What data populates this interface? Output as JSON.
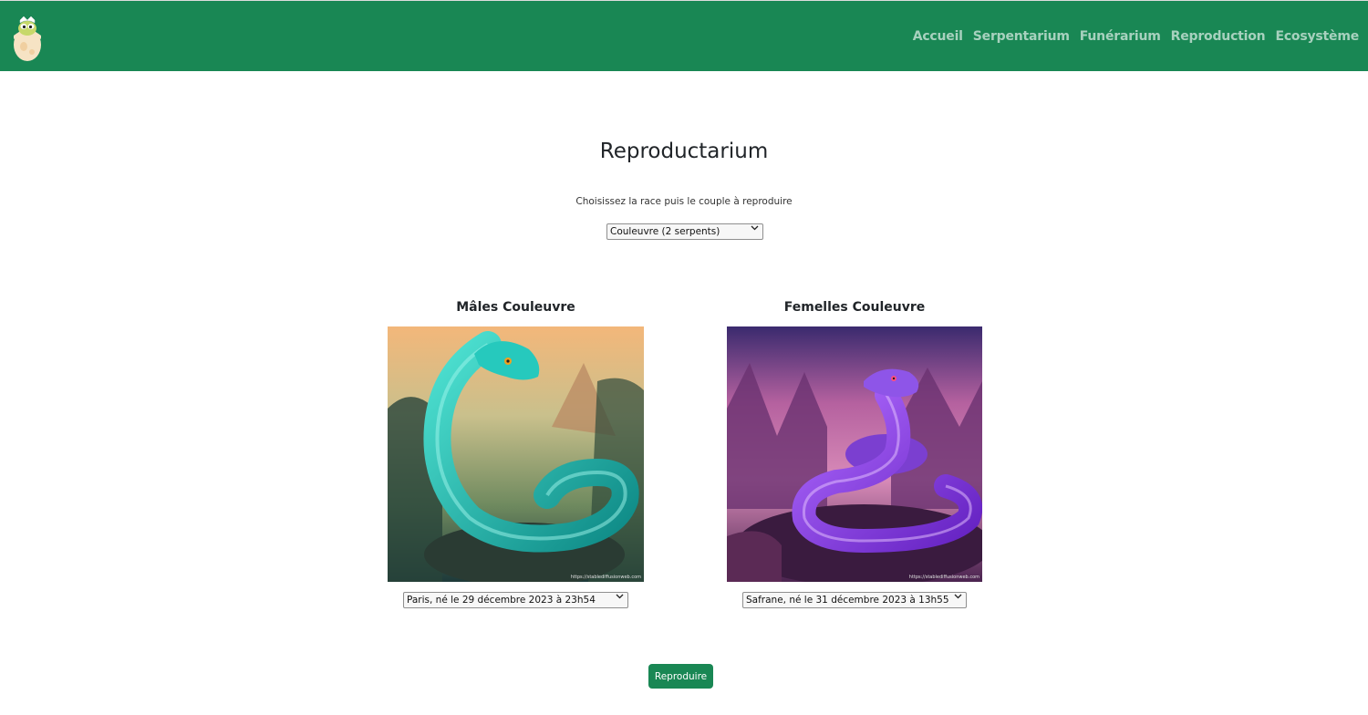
{
  "nav": {
    "logo_icon": "hatching-snake-egg-icon",
    "links": [
      "Accueil",
      "Serpentarium",
      "Funérarium",
      "Reproduction",
      "Ecosystème"
    ]
  },
  "main": {
    "title": "Reproductarium",
    "instructions": "Choisissez la race puis le couple à reproduire",
    "race_select": {
      "selected": "Couleuvre (2 serpents)"
    }
  },
  "males": {
    "title": "Mâles Couleuvre",
    "image": "teal-snake-image",
    "watermark": "https://stablediffusionweb.com",
    "select": {
      "selected": "Paris, né le 29 décembre 2023 à 23h54"
    }
  },
  "females": {
    "title": "Femelles Couleuvre",
    "image": "purple-snake-image",
    "watermark": "https://stablediffusionweb.com",
    "select": {
      "selected": "Safrane, né le 31 décembre 2023 à 13h55"
    }
  },
  "actions": {
    "reproduce_label": "Reproduire"
  },
  "colors": {
    "brand_green": "#198754",
    "nav_text": "#b9dcc9"
  }
}
